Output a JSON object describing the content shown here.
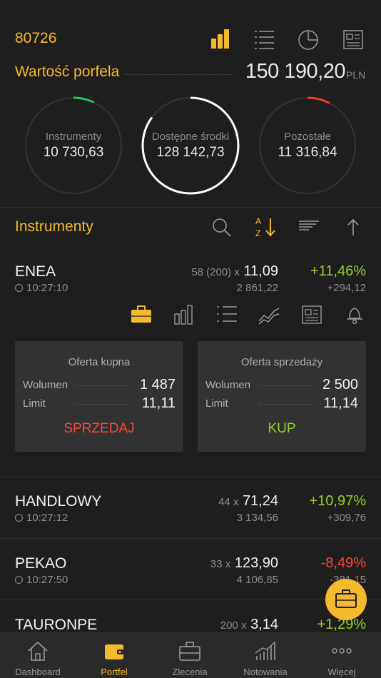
{
  "header": {
    "account": "80726",
    "icons": [
      "bar-chart-icon",
      "list-icon",
      "pie-chart-icon",
      "news-icon"
    ]
  },
  "portfolio": {
    "label": "Wartość porfela",
    "value": "150 190,20",
    "currency": "PLN"
  },
  "summary": [
    {
      "label": "Instrumenty",
      "value": "10 730,63",
      "arc_color": "#22c55e",
      "arc_fraction": 0.07
    },
    {
      "label": "Dostępne środki",
      "value": "128 142,73",
      "arc_color": "#ffffff",
      "arc_fraction": 0.85
    },
    {
      "label": "Pozostałe",
      "value": "11 316,84",
      "arc_color": "#ef3b2c",
      "arc_fraction": 0.075
    }
  ],
  "instruments_section": {
    "title": "Instrumenty",
    "sort_glyph_top": "A",
    "sort_glyph_bottom": "Z"
  },
  "instruments": [
    {
      "name": "ENEA",
      "time": "10:27:10",
      "qty": "58 (200) x",
      "price": "11,09",
      "sum": "2 861,22",
      "change": "+11,46%",
      "change_abs": "+294,12",
      "trend": "up"
    },
    {
      "name": "HANDLOWY",
      "time": "10:27:12",
      "qty": "44 x",
      "price": "71,24",
      "sum": "3 134,56",
      "change": "+10,97%",
      "change_abs": "+309,76",
      "trend": "up"
    },
    {
      "name": "PEKAO",
      "time": "10:27:50",
      "qty": "33 x",
      "price": "123,90",
      "sum": "4 106,85",
      "change": "-8,49%",
      "change_abs": "-381,15",
      "trend": "down"
    },
    {
      "name": "TAURONPE",
      "time": "",
      "qty": "200 x",
      "price": "3,14",
      "sum": "",
      "change": "+1,29%",
      "change_abs": "",
      "trend": "up"
    }
  ],
  "orderbook": {
    "buy": {
      "title": "Oferta kupna",
      "volume_label": "Wolumen",
      "volume": "1 487",
      "limit_label": "Limit",
      "limit": "11,11",
      "action": "SPRZEDAJ"
    },
    "sell": {
      "title": "Oferta sprzedaży",
      "volume_label": "Wolumen",
      "volume": "2 500",
      "limit_label": "Limit",
      "limit": "11,14",
      "action": "KUP"
    }
  },
  "tabs": [
    {
      "label": "Dashboard",
      "icon": "home-icon",
      "active": false
    },
    {
      "label": "Portfel",
      "icon": "wallet-icon",
      "active": true
    },
    {
      "label": "Zlecenia",
      "icon": "briefcase-icon",
      "active": false
    },
    {
      "label": "Notowania",
      "icon": "growth-chart-icon",
      "active": false
    },
    {
      "label": "Więcej",
      "icon": "more-icon",
      "active": false
    }
  ],
  "colors": {
    "accent": "#f5b92e",
    "positive": "#9acd32",
    "negative": "#ff4433",
    "background": "#1e1e1e"
  }
}
